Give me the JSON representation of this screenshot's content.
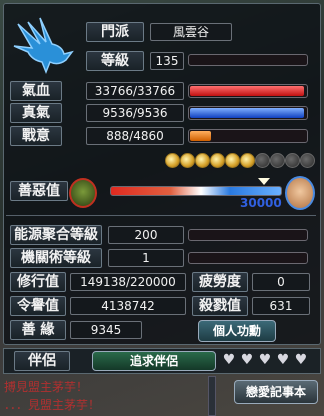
{
  "header": {
    "sect_label": "門派",
    "sect_value": "風雲谷",
    "level_label": "等級",
    "level_value": "135"
  },
  "stats": {
    "hp": {
      "label": "氣血",
      "value": "33766/33766",
      "fraction": 1.0
    },
    "mp": {
      "label": "真氣",
      "value": "9536/9536",
      "fraction": 1.0
    },
    "fight": {
      "label": "戰意",
      "value": "888/4860",
      "fraction": 0.18
    }
  },
  "coins": {
    "filled": 6,
    "total": 10
  },
  "morality": {
    "label": "善惡值",
    "value": "30000",
    "marker": 0.97
  },
  "skills": [
    {
      "label": "能源聚合等級",
      "value": "200"
    },
    {
      "label": "機關術等級",
      "value": "1"
    }
  ],
  "info": {
    "cultivation_label": "修行值",
    "cultivation_value": "149138/220000",
    "fatigue_label": "疲勞度",
    "fatigue_value": "0",
    "reputation_label": "令譽值",
    "reputation_value": "4138742",
    "kills_label": "殺戮值",
    "kills_value": "631",
    "karma_label": "善 緣",
    "karma_value": "9345",
    "merit_button": "個人功勳"
  },
  "partner": {
    "label": "伴侶",
    "seek_button": "追求伴侶",
    "hearts": 5
  },
  "chat": {
    "line1": "搏見盟主茅芋！",
    "line2": "．．．見盟主茅芋！",
    "diary_button": "戀愛記事本"
  },
  "colors": {
    "hp": "#d02020",
    "mp": "#2060e0",
    "fight": "#f08010",
    "good": "#2a7ae0",
    "evil": "#e02a20"
  }
}
